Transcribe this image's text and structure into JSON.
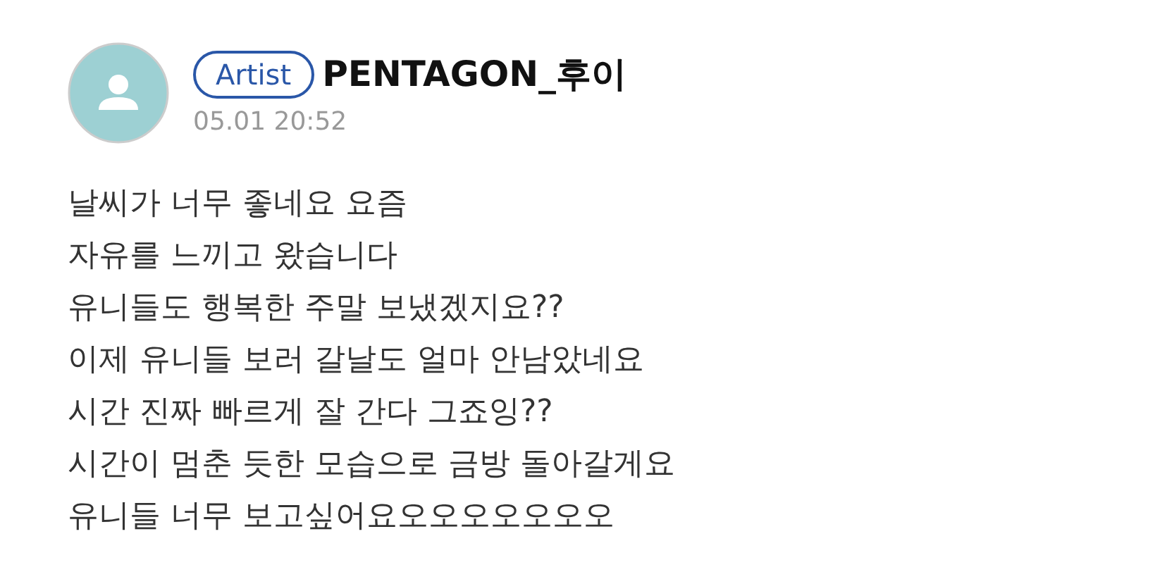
{
  "post": {
    "badge": "Artist",
    "author": "PENTAGON_후이",
    "time": "05.01 20:52",
    "lines": [
      "날씨가 너무 좋네요 요즘",
      "자유를 느끼고 왔습니다",
      "유니들도 행복한 주말 보냈겠지요??",
      "이제 유니들 보러 갈날도 얼마 안남았네요",
      "시간 진짜 빠르게 잘 간다 그죠잉??",
      "시간이 멈춘 듯한 모습으로 금방 돌아갈게요",
      "유니들 너무 보고싶어요오오오오오오오"
    ]
  }
}
